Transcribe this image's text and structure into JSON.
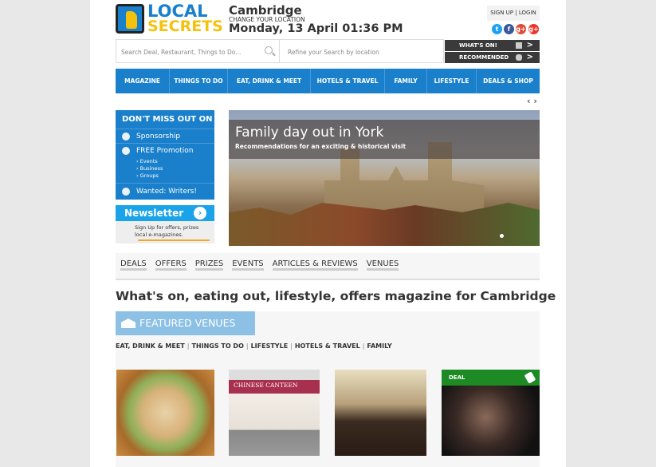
{
  "logo": {
    "line1": "LOCAL",
    "line2": "SECRETS"
  },
  "header": {
    "city": "Cambridge",
    "change_location": "CHANGE YOUR LOCATION",
    "datetime": "Monday, 13 April 01:36 PM",
    "signup": "SIGN UP",
    "login": "LOGIN",
    "sep": "|"
  },
  "social": [
    {
      "name": "twitter",
      "label": "t",
      "color": "#1da1f2"
    },
    {
      "name": "facebook",
      "label": "f",
      "color": "#3b5998"
    },
    {
      "name": "google-plus",
      "label": "g+",
      "color": "#dd4b39"
    },
    {
      "name": "google-plus-2",
      "label": "g+",
      "color": "#e8372a"
    }
  ],
  "search": {
    "placeholder": "Search Deal, Restaurant, Things to Do...",
    "location_placeholder": "Refine your Search by location"
  },
  "quick": {
    "whats_on": "WHAT'S ON!",
    "recommended": "RECOMMENDED"
  },
  "nav": [
    "MAGAZINE",
    "THINGS TO DO",
    "EAT, DRINK & MEET",
    "HOTELS & TRAVEL",
    "FAMILY",
    "LIFESTYLE",
    "DEALS & SHOP"
  ],
  "sidebar": {
    "title": "DON'T MISS OUT ON",
    "sponsorship": "Sponsorship",
    "promotion": "FREE Promotion",
    "sub": [
      "› Events",
      "› Business",
      "› Groups"
    ],
    "writers": "Wanted: Writers!"
  },
  "newsletter": {
    "title": "Newsletter",
    "line1": "Sign Up for offers, prizes",
    "line2": "local e-magazines."
  },
  "hero": {
    "title": "Family day out in York",
    "subtitle": "Recommendations for an exciting & historical visit"
  },
  "tabs": [
    "DEALS",
    "OFFERS",
    "PRIZES",
    "EVENTS",
    "ARTICLES & REVIEWS",
    "VENUES"
  ],
  "heading": "What's on, eating out, lifestyle, offers magazine for Cambridge",
  "featured": {
    "title": "FEATURED VENUES",
    "categories": [
      "EAT, DRINK & MEET",
      "THINGS TO DO",
      "LIFESTYLE",
      "HOTELS & TRAVEL",
      "FAMILY"
    ],
    "deal_badge": "DEAL",
    "canteen_sign": "CHINESE CANTEEN"
  },
  "colors": {
    "brand_blue": "#1a80cc",
    "brand_yellow": "#f4c20d",
    "deal_green": "#1e8a23"
  }
}
